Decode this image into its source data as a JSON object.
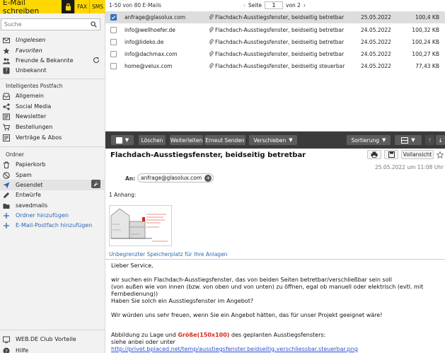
{
  "topbar": {
    "compose_label": "E-Mail schreiben",
    "fax_label": "FAX",
    "sms_label": "SMS"
  },
  "search": {
    "placeholder": "Suche"
  },
  "sidebar": {
    "smart_items": [
      {
        "label": "Ungelesen",
        "icon": "envelope-icon"
      },
      {
        "label": "Favoriten",
        "icon": "star-icon"
      },
      {
        "label": "Freunde & Bekannte",
        "icon": "people-icon"
      },
      {
        "label": "Unbekannt",
        "icon": "unknown-icon"
      }
    ],
    "section_smart": "Intelligentes Postfach",
    "postfach_items": [
      {
        "label": "Allgemein",
        "icon": "inbox-icon"
      },
      {
        "label": "Social Media",
        "icon": "social-icon"
      },
      {
        "label": "Newsletter",
        "icon": "newsletter-icon"
      },
      {
        "label": "Bestellungen",
        "icon": "cart-icon"
      },
      {
        "label": "Verträge & Abos",
        "icon": "contract-icon"
      }
    ],
    "section_folders": "Ordner",
    "folders": [
      {
        "label": "Papierkorb",
        "icon": "trash-icon"
      },
      {
        "label": "Spam",
        "icon": "spam-icon"
      },
      {
        "label": "Gesendet",
        "icon": "sent-icon"
      },
      {
        "label": "Entwürfe",
        "icon": "drafts-icon"
      },
      {
        "label": "savedmails",
        "icon": "folder-icon"
      }
    ],
    "add_folder": "Ordner hinzufügen",
    "add_mailbox": "E-Mail-Postfach hinzufügen",
    "club": "WEB.DE Club Vorteile",
    "help": "Hilfe"
  },
  "list": {
    "range": "1-50 von 80 E-Mails",
    "page_label": "Seite",
    "page_value": "1",
    "page_of": "von 2",
    "rows": [
      {
        "from": "anfrage@glasolux.com",
        "subject": "Flachdach-Ausstiegsfenster, beidseitig betretbar",
        "date": "25.05.2022",
        "size": "100,4 KB",
        "selected": true
      },
      {
        "from": "info@wellhoefer.de",
        "subject": "Flachdach-Ausstiegsfenster, beidseitig betretbar",
        "date": "24.05.2022",
        "size": "100,32 KB",
        "selected": false
      },
      {
        "from": "info@lideko.de",
        "subject": "Flachdach-Ausstiegsfenster, beidseitig betretbar",
        "date": "24.05.2022",
        "size": "100,24 KB",
        "selected": false
      },
      {
        "from": "info@dachmax.com",
        "subject": "Flachdach-Ausstiegsfenster, beidseitig betretbar",
        "date": "24.05.2022",
        "size": "100,27 KB",
        "selected": false
      },
      {
        "from": "home@velux.com",
        "subject": "Flachdach-Ausstiegsfenster, beidseitig steuerbar",
        "date": "24.05.2022",
        "size": "77,43 KB",
        "selected": false
      }
    ]
  },
  "toolbar": {
    "delete": "Löschen",
    "forward": "Weiterleiten",
    "resend": "Erneut Senden",
    "move": "Verschieben",
    "sort": "Sortierung"
  },
  "message": {
    "subject": "Flachdach-Ausstiegsfenster, beidseitig betretbar",
    "fullview": "Vollansicht",
    "datetime": "25.05.2022 um 11:08 Uhr",
    "to_label": "An:",
    "to_value": "anfrage@glasolux.com",
    "attach_label": "1 Anhang:",
    "storage_link": "Unbegrenzter Speicherplatz für Ihre Anlagen",
    "greeting": "Lieber Service,",
    "p1_l1": "wir suchen ein Flachdach-Ausstiegsfenster, das von beiden Seiten betretbar/verschließbar sein soll",
    "p1_l2": "(von außen wie von innen (bzw. von oben und von unten) zu öffnen, egal ob manuell oder elektrisch (evtl. mit",
    "p1_l3": "Fernbedienung))",
    "p1_l4": "Haben Sie solch ein Ausstiegsfenster im Angebot?",
    "p2": "Wir würden uns sehr freuen, wenn Sie ein Angebot hätten, das für unser Projekt geeignet wäre!",
    "p3_a": "Abbildung zu Lage und ",
    "p3_red": "Größe(150x100)",
    "p3_b": " des geplanten Ausstiegsfensters:",
    "p3_l2": "siehe anbei oder unter",
    "p3_link": "http://privet.bplaced.net/temp/ausstiegsfenster.beidseitig.verschliessbar.steuerbar.png"
  },
  "colors": {
    "brand_yellow": "#ffd800",
    "toolbar_dark": "#3b3b3b",
    "link_blue": "#2b69b3",
    "accent_red": "#d6281c"
  }
}
